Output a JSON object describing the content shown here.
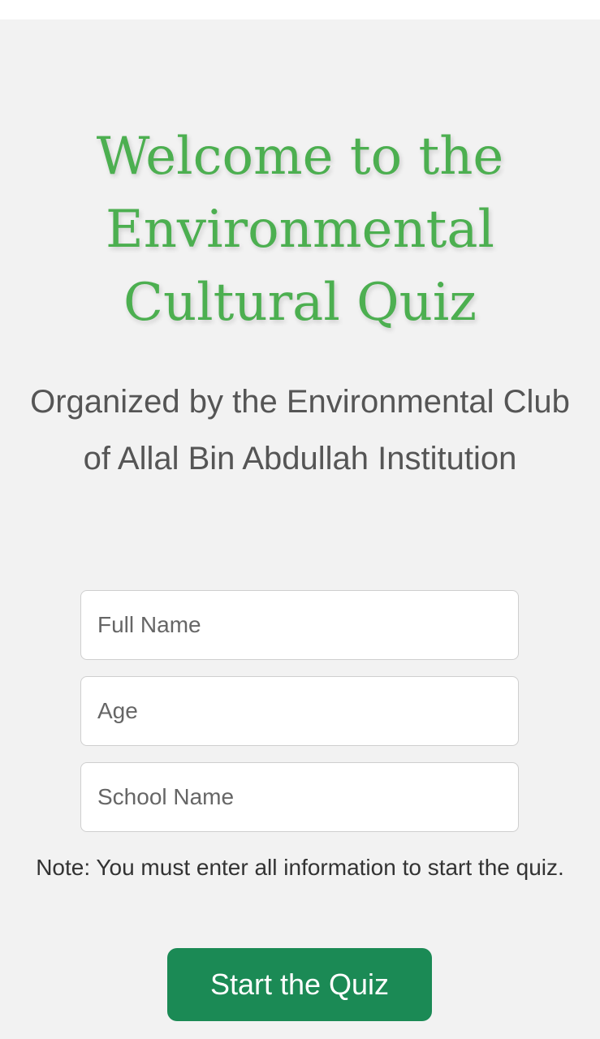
{
  "title": "Welcome to the Environmental Cultural Quiz",
  "subtitle": "Organized by the Environmental Club of Allal Bin Abdullah Institution",
  "form": {
    "full_name_placeholder": "Full Name",
    "age_placeholder": "Age",
    "school_placeholder": "School Name"
  },
  "note": "Note: You must enter all information to start the quiz.",
  "start_button": "Start the Quiz",
  "colors": {
    "title": "#4caf50",
    "button": "#1b8a55",
    "background": "#f2f2f2"
  }
}
